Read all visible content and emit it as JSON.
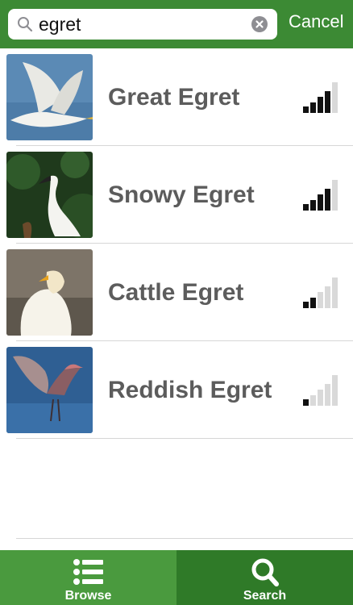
{
  "search": {
    "value": "egret",
    "cancel_label": "Cancel"
  },
  "results": [
    {
      "name": "Great Egret",
      "abundance_level": 4,
      "icon": "great-egret-photo"
    },
    {
      "name": "Snowy Egret",
      "abundance_level": 4,
      "icon": "snowy-egret-photo"
    },
    {
      "name": "Cattle Egret",
      "abundance_level": 2,
      "icon": "cattle-egret-photo"
    },
    {
      "name": "Reddish Egret",
      "abundance_level": 1,
      "icon": "reddish-egret-photo"
    }
  ],
  "tabs": [
    {
      "label": "Browse",
      "icon": "list-icon",
      "selected": false
    },
    {
      "label": "Search",
      "icon": "search-icon",
      "selected": true
    }
  ],
  "colors": {
    "brand_green": "#3c8a34",
    "tab_browse": "#4a9a3e",
    "tab_search_active": "#2f7a28",
    "signal_active": "#111111",
    "signal_inactive": "#d9d9d9",
    "name_text": "#5c5c5c"
  }
}
